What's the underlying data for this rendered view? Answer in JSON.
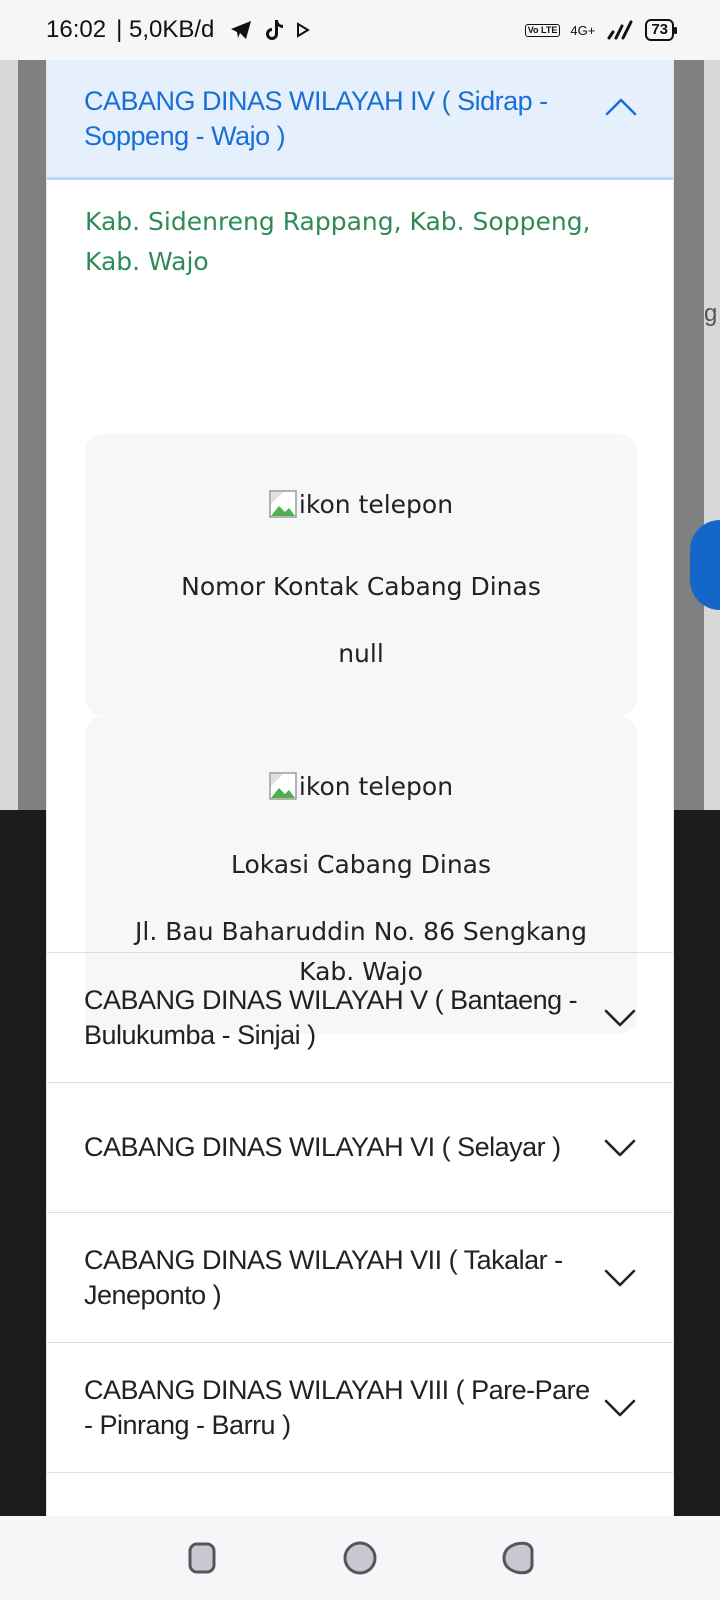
{
  "status_bar": {
    "time": "16:02",
    "speed": "| 5,0KB/d",
    "volte": "Vo LTE",
    "network": "4G+",
    "battery": "73"
  },
  "accordion": {
    "open_item": {
      "title": "CABANG DINAS WILAYAH IV ( Sidrap - Soppeng - Wajo )",
      "coverage": "Kab. Sidenreng Rappang, Kab. Soppeng, Kab. Wajo",
      "contact_card": {
        "image_alt": "ikon telepon",
        "label": "Nomor Kontak Cabang Dinas",
        "value": "null"
      },
      "location_card": {
        "image_alt": "ikon telepon",
        "label": "Lokasi Cabang Dinas",
        "value": "Jl. Bau Baharuddin No. 86 Sengkang Kab. Wajo"
      }
    },
    "items": [
      {
        "title": "CABANG DINAS WILAYAH V ( Bantaeng - Bulukumba - Sinjai )"
      },
      {
        "title": "CABANG DINAS WILAYAH VI ( Selayar )"
      },
      {
        "title": "CABANG DINAS WILAYAH VII ( Takalar - Jeneponto )"
      },
      {
        "title": "CABANG DINAS WILAYAH VIII ( Pare-Pare - Pinrang - Barru )"
      }
    ]
  },
  "background": {
    "partial_letter": "g"
  },
  "colors": {
    "accent_blue": "#1a6fd6",
    "open_header_bg": "#e6f0fc",
    "coverage_green": "#2e8b57",
    "card_bg": "#f6f7f9"
  },
  "icons": [
    "telegram-icon",
    "tiktok-icon",
    "play-icon",
    "signal-icon",
    "chevron-up-icon",
    "chevron-down-icon",
    "recents-icon",
    "home-icon",
    "back-icon"
  ]
}
